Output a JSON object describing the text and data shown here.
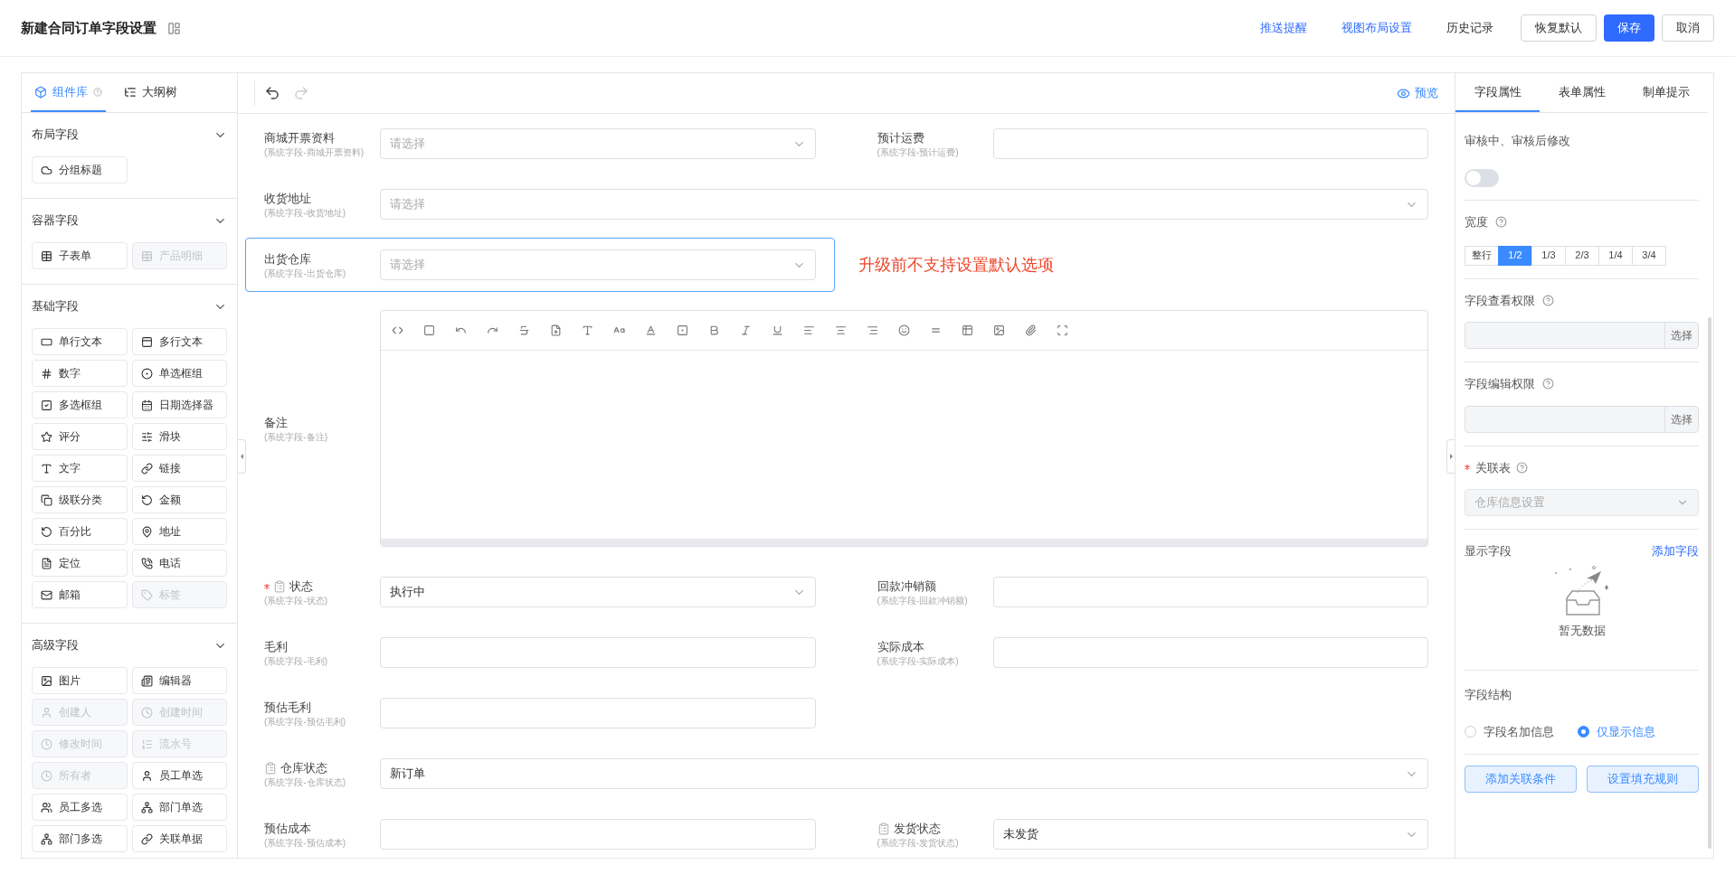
{
  "header": {
    "title": "新建合同订单字段设置",
    "links": [
      "推送提醒",
      "视图布局设置"
    ],
    "history": "历史记录",
    "buttons": [
      {
        "label": "恢复默认",
        "kind": "outline"
      },
      {
        "label": "保存",
        "kind": "primary"
      },
      {
        "label": "取消",
        "kind": "outline"
      }
    ]
  },
  "left_panel": {
    "tabs": [
      {
        "label": "组件库",
        "selected": true
      },
      {
        "label": "大纲树",
        "selected": false
      }
    ],
    "sections": [
      {
        "title": "布局字段",
        "expanded": true,
        "items": [
          {
            "label": "分组标题",
            "disabled": false
          }
        ]
      },
      {
        "title": "容器字段",
        "expanded": true,
        "items": [
          {
            "label": "子表单",
            "disabled": false
          },
          {
            "label": "产品明细",
            "disabled": true
          }
        ]
      },
      {
        "title": "基础字段",
        "expanded": true,
        "items": [
          {
            "label": "单行文本",
            "disabled": false
          },
          {
            "label": "多行文本",
            "disabled": false
          },
          {
            "label": "数字",
            "disabled": false
          },
          {
            "label": "单选框组",
            "disabled": false
          },
          {
            "label": "多选框组",
            "disabled": false
          },
          {
            "label": "日期选择器",
            "disabled": false
          },
          {
            "label": "评分",
            "disabled": false
          },
          {
            "label": "滑块",
            "disabled": false
          },
          {
            "label": "文字",
            "disabled": false
          },
          {
            "label": "链接",
            "disabled": false
          },
          {
            "label": "级联分类",
            "disabled": false
          },
          {
            "label": "金额",
            "disabled": false
          },
          {
            "label": "百分比",
            "disabled": false
          },
          {
            "label": "地址",
            "disabled": false
          },
          {
            "label": "定位",
            "disabled": false
          },
          {
            "label": "电话",
            "disabled": false
          },
          {
            "label": "邮箱",
            "disabled": false
          },
          {
            "label": "标签",
            "disabled": true
          }
        ]
      },
      {
        "title": "高级字段",
        "expanded": true,
        "items": [
          {
            "label": "图片",
            "disabled": false
          },
          {
            "label": "编辑器",
            "disabled": false
          },
          {
            "label": "创建人",
            "disabled": true
          },
          {
            "label": "创建时间",
            "disabled": true
          },
          {
            "label": "修改时间",
            "disabled": true
          },
          {
            "label": "流水号",
            "disabled": true
          },
          {
            "label": "所有者",
            "disabled": true
          },
          {
            "label": "员工单选",
            "disabled": false
          },
          {
            "label": "员工多选",
            "disabled": false
          },
          {
            "label": "部门单选",
            "disabled": false
          },
          {
            "label": "部门多选",
            "disabled": false
          },
          {
            "label": "关联单据",
            "disabled": false
          }
        ]
      }
    ]
  },
  "canvas": {
    "preview": "预览",
    "undo_enabled": true,
    "redo_enabled": false,
    "rows": [
      {
        "fields": [
          {
            "label": "商城开票资料",
            "sublabel": "(系统字段-商城开票资料)",
            "kind": "select",
            "placeholder": "请选择",
            "full_width": false,
            "selected": false,
            "required": false,
            "locked": false
          },
          {
            "label": "预计运费",
            "sublabel": "(系统字段-预计运费)",
            "kind": "input",
            "full_width": false,
            "selected": false,
            "required": false,
            "locked": false
          }
        ]
      },
      {
        "fields": [
          {
            "label": "收货地址",
            "sublabel": "(系统字段-收货地址)",
            "kind": "select",
            "placeholder": "请选择",
            "full_width": true,
            "selected": false,
            "required": false,
            "locked": false
          }
        ]
      },
      {
        "fields": [
          {
            "label": "出货仓库",
            "sublabel": "(系统字段-出货仓库)",
            "kind": "select",
            "placeholder": "请选择",
            "full_width": false,
            "selected": true,
            "required": false,
            "locked": false
          }
        ],
        "annotation": "升级前不支持设置默认选项"
      },
      {
        "fields": [
          {
            "label": "备注",
            "sublabel": "(系统字段-备注)",
            "kind": "editor",
            "full_width": true,
            "selected": false,
            "required": false,
            "locked": false
          }
        ]
      },
      {
        "fields": [
          {
            "label": "状态",
            "sublabel": "(系统字段-状态)",
            "kind": "select",
            "value": "执行中",
            "full_width": false,
            "selected": false,
            "required": true,
            "locked": true
          },
          {
            "label": "回款冲销额",
            "sublabel": "(系统字段-回款冲销额)",
            "kind": "input",
            "full_width": false,
            "selected": false,
            "required": false,
            "locked": false
          }
        ]
      },
      {
        "fields": [
          {
            "label": "毛利",
            "sublabel": "(系统字段-毛利)",
            "kind": "input",
            "full_width": false,
            "selected": false,
            "required": false,
            "locked": false
          },
          {
            "label": "实际成本",
            "sublabel": "(系统字段-实际成本)",
            "kind": "input",
            "full_width": false,
            "selected": false,
            "required": false,
            "locked": false
          }
        ]
      },
      {
        "fields": [
          {
            "label": "预估毛利",
            "sublabel": "(系统字段-预估毛利)",
            "kind": "input",
            "full_width": false,
            "selected": false,
            "required": false,
            "locked": false
          }
        ]
      },
      {
        "fields": [
          {
            "label": "仓库状态",
            "sublabel": "(系统字段-仓库状态)",
            "kind": "select",
            "value": "新订单",
            "full_width": true,
            "selected": false,
            "required": false,
            "locked": true
          }
        ]
      },
      {
        "fields": [
          {
            "label": "预估成本",
            "sublabel": "(系统字段-预估成本)",
            "kind": "input",
            "full_width": false,
            "selected": false,
            "required": false,
            "locked": false
          },
          {
            "label": "发货状态",
            "sublabel": "(系统字段-发货状态)",
            "kind": "select",
            "value": "未发货",
            "full_width": false,
            "selected": false,
            "required": false,
            "locked": true
          }
        ]
      }
    ]
  },
  "properties": {
    "tabs": [
      {
        "label": "字段属性",
        "selected": true
      },
      {
        "label": "表单属性",
        "selected": false
      },
      {
        "label": "制单提示",
        "selected": false
      }
    ],
    "review_edit": {
      "label": "审核中、审核后修改",
      "on": false
    },
    "width": {
      "label": "宽度",
      "options": [
        {
          "label": "整行",
          "selected": false
        },
        {
          "label": "1/2",
          "selected": true
        },
        {
          "label": "1/3",
          "selected": false
        },
        {
          "label": "2/3",
          "selected": false
        },
        {
          "label": "1/4",
          "selected": false
        },
        {
          "label": "3/4",
          "selected": false
        }
      ]
    },
    "permissions": [
      {
        "label": "字段查看权限",
        "button": "选择"
      },
      {
        "label": "字段编辑权限",
        "button": "选择"
      }
    ],
    "related_table": {
      "label": "关联表",
      "required": true,
      "value": "仓库信息设置",
      "disabled": true
    },
    "display_fields": {
      "label": "显示字段",
      "link": "添加字段",
      "empty_text": "暂无数据"
    },
    "structure": {
      "label": "字段结构",
      "options": [
        {
          "label": "字段名加信息",
          "selected": false
        },
        {
          "label": "仅显示信息",
          "selected": true
        }
      ]
    },
    "buttons": [
      "添加关联条件",
      "设置填充规则"
    ]
  }
}
